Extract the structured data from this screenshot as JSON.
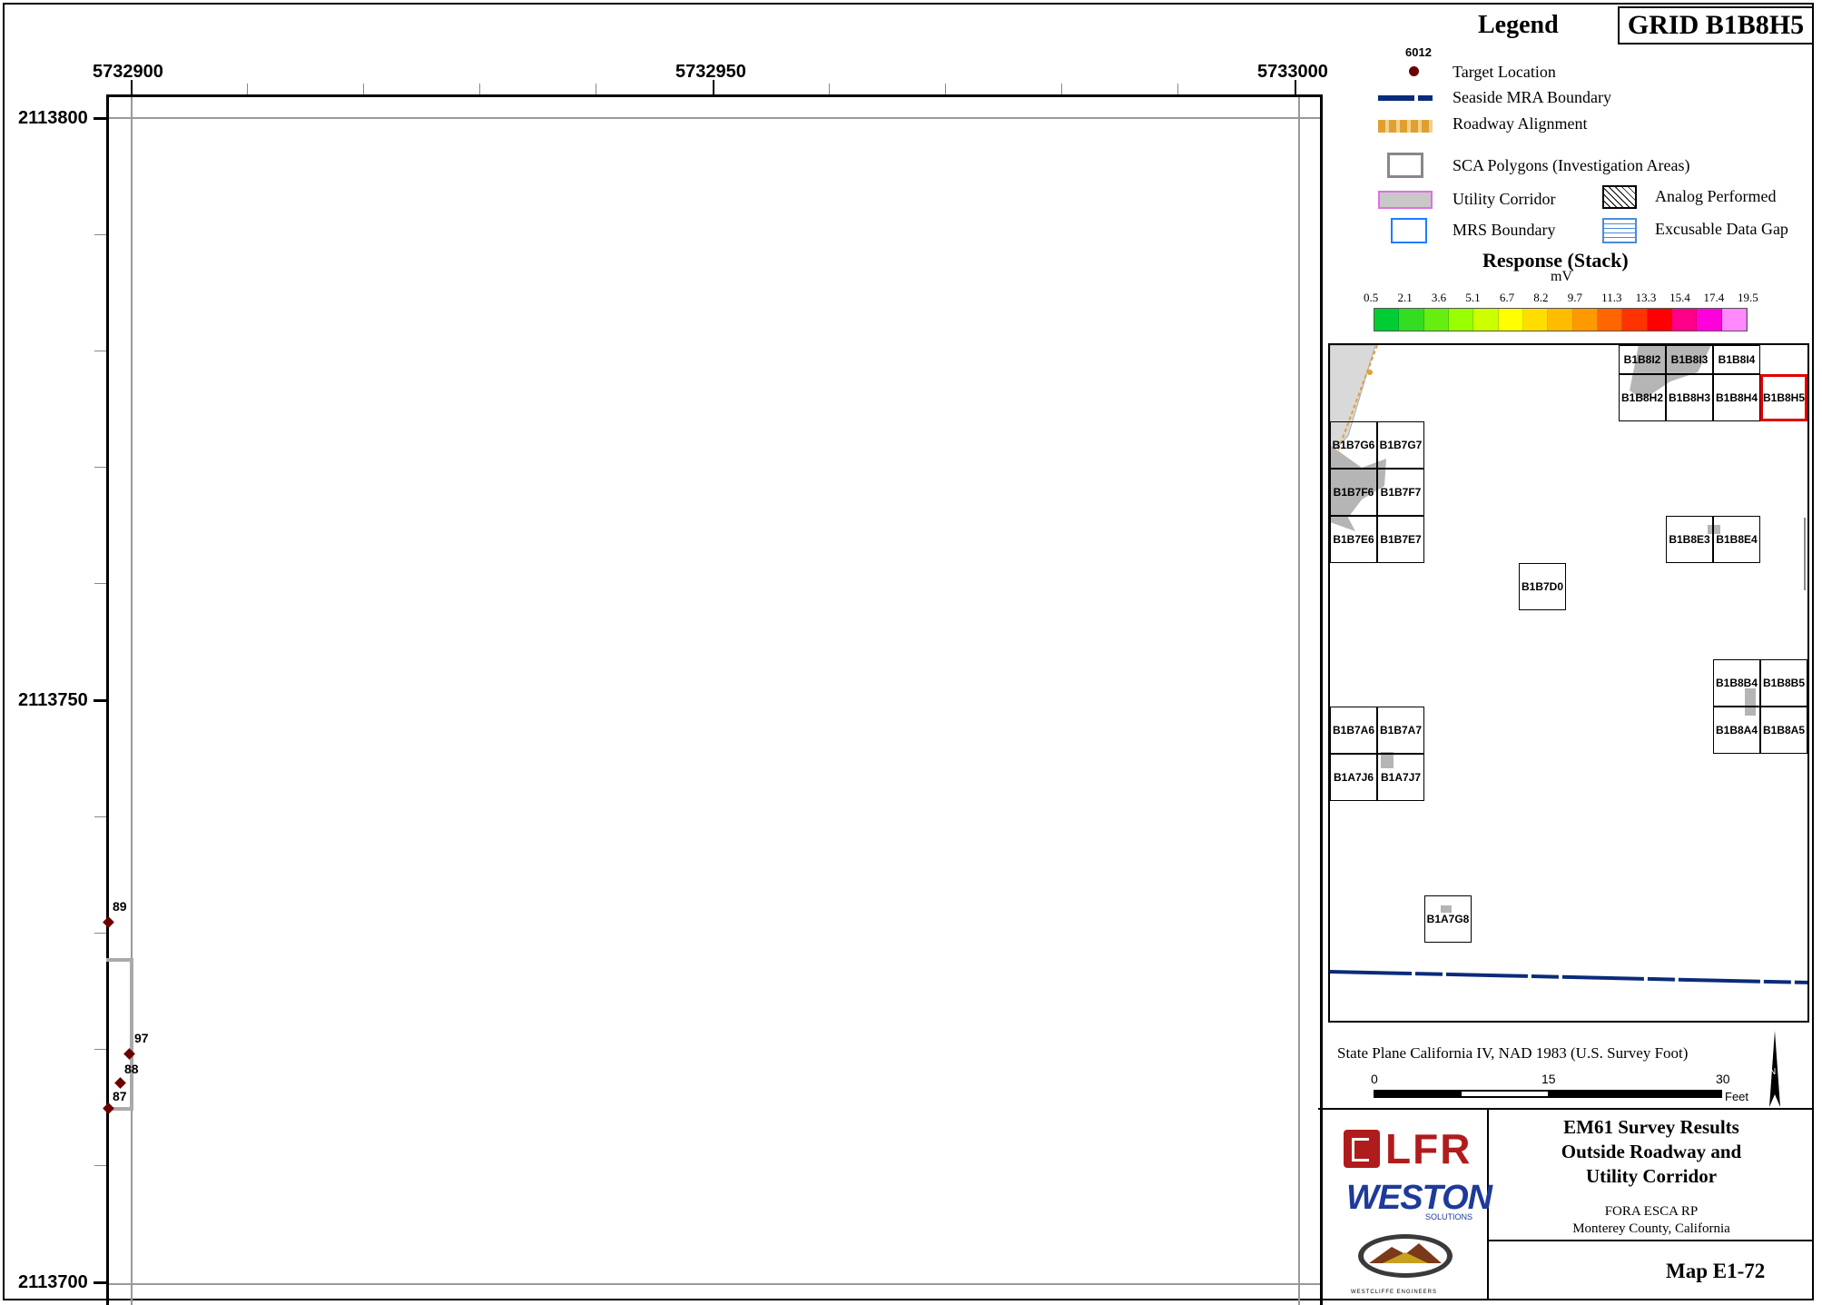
{
  "grid_id": "GRID B1B8H5",
  "axes": {
    "x_labels": [
      "5732900",
      "5732950",
      "5733000"
    ],
    "y_labels": [
      "2113800",
      "2113750",
      "2113700"
    ]
  },
  "map": {
    "sca_polygon": true,
    "targets": [
      {
        "label": "89"
      },
      {
        "label": "97"
      },
      {
        "label": "88"
      },
      {
        "label": "87"
      }
    ]
  },
  "legend": {
    "title": "Legend",
    "sample_target_label": "6012",
    "items": {
      "target_location": "Target Location",
      "seaside_mra": "Seaside MRA Boundary",
      "roadway": "Roadway Alignment",
      "sca_polygons": "SCA Polygons (Investigation Areas)",
      "utility_corridor": "Utility Corridor",
      "analog_performed": "Analog Performed",
      "mrs_boundary": "MRS Boundary",
      "excusable_gap": "Excusable Data Gap"
    },
    "response_title": "Response (Stack)",
    "response_unit": "mV",
    "scale_values": [
      "0.5",
      "2.1",
      "3.6",
      "5.1",
      "6.7",
      "8.2",
      "9.7",
      "11.3",
      "13.3",
      "15.4",
      "17.4",
      "19.5"
    ],
    "scale_colors": [
      "#00cc33",
      "#33dd22",
      "#66ee11",
      "#99ff00",
      "#ccff00",
      "#ffff00",
      "#ffdd00",
      "#ffbb00",
      "#ff9900",
      "#ff6600",
      "#ff3300",
      "#ff0000",
      "#ff0088",
      "#ff00dd",
      "#ff88ff"
    ]
  },
  "index_map": {
    "cells": [
      "B1B8I2",
      "B1B8I3",
      "B1B8I4",
      "B1B8H2",
      "B1B8H3",
      "B1B8H4",
      "B1B8H5",
      "B1B7G6",
      "B1B7G7",
      "B1B7F6",
      "B1B7F7",
      "B1B7E6",
      "B1B7E7",
      "B1B8E3",
      "B1B8E4",
      "B1B7D0",
      "B1B8B4",
      "B1B8B5",
      "B1B8A4",
      "B1B8A5",
      "B1B7A6",
      "B1B7A7",
      "B1A7J6",
      "B1A7J7",
      "B1A7G8"
    ],
    "highlight": "B1B8H5"
  },
  "projection": "State Plane California IV, NAD 1983 (U.S. Survey Foot)",
  "scalebar": {
    "labels": [
      "0",
      "15",
      "30"
    ],
    "unit": "Feet"
  },
  "title_block": {
    "logo_lfr": "LFR",
    "logo_weston": "WESTON",
    "logo_weston_sub": "SOLUTIONS",
    "logo_westcliffe": "WESTCLIFFE ENGINEERS",
    "title_line1": "EM61 Survey Results",
    "title_line2": "Outside Roadway and",
    "title_line3": "Utility Corridor",
    "project": "FORA ESCA RP",
    "location": "Monterey County, California",
    "map_no": "Map E1-72"
  }
}
